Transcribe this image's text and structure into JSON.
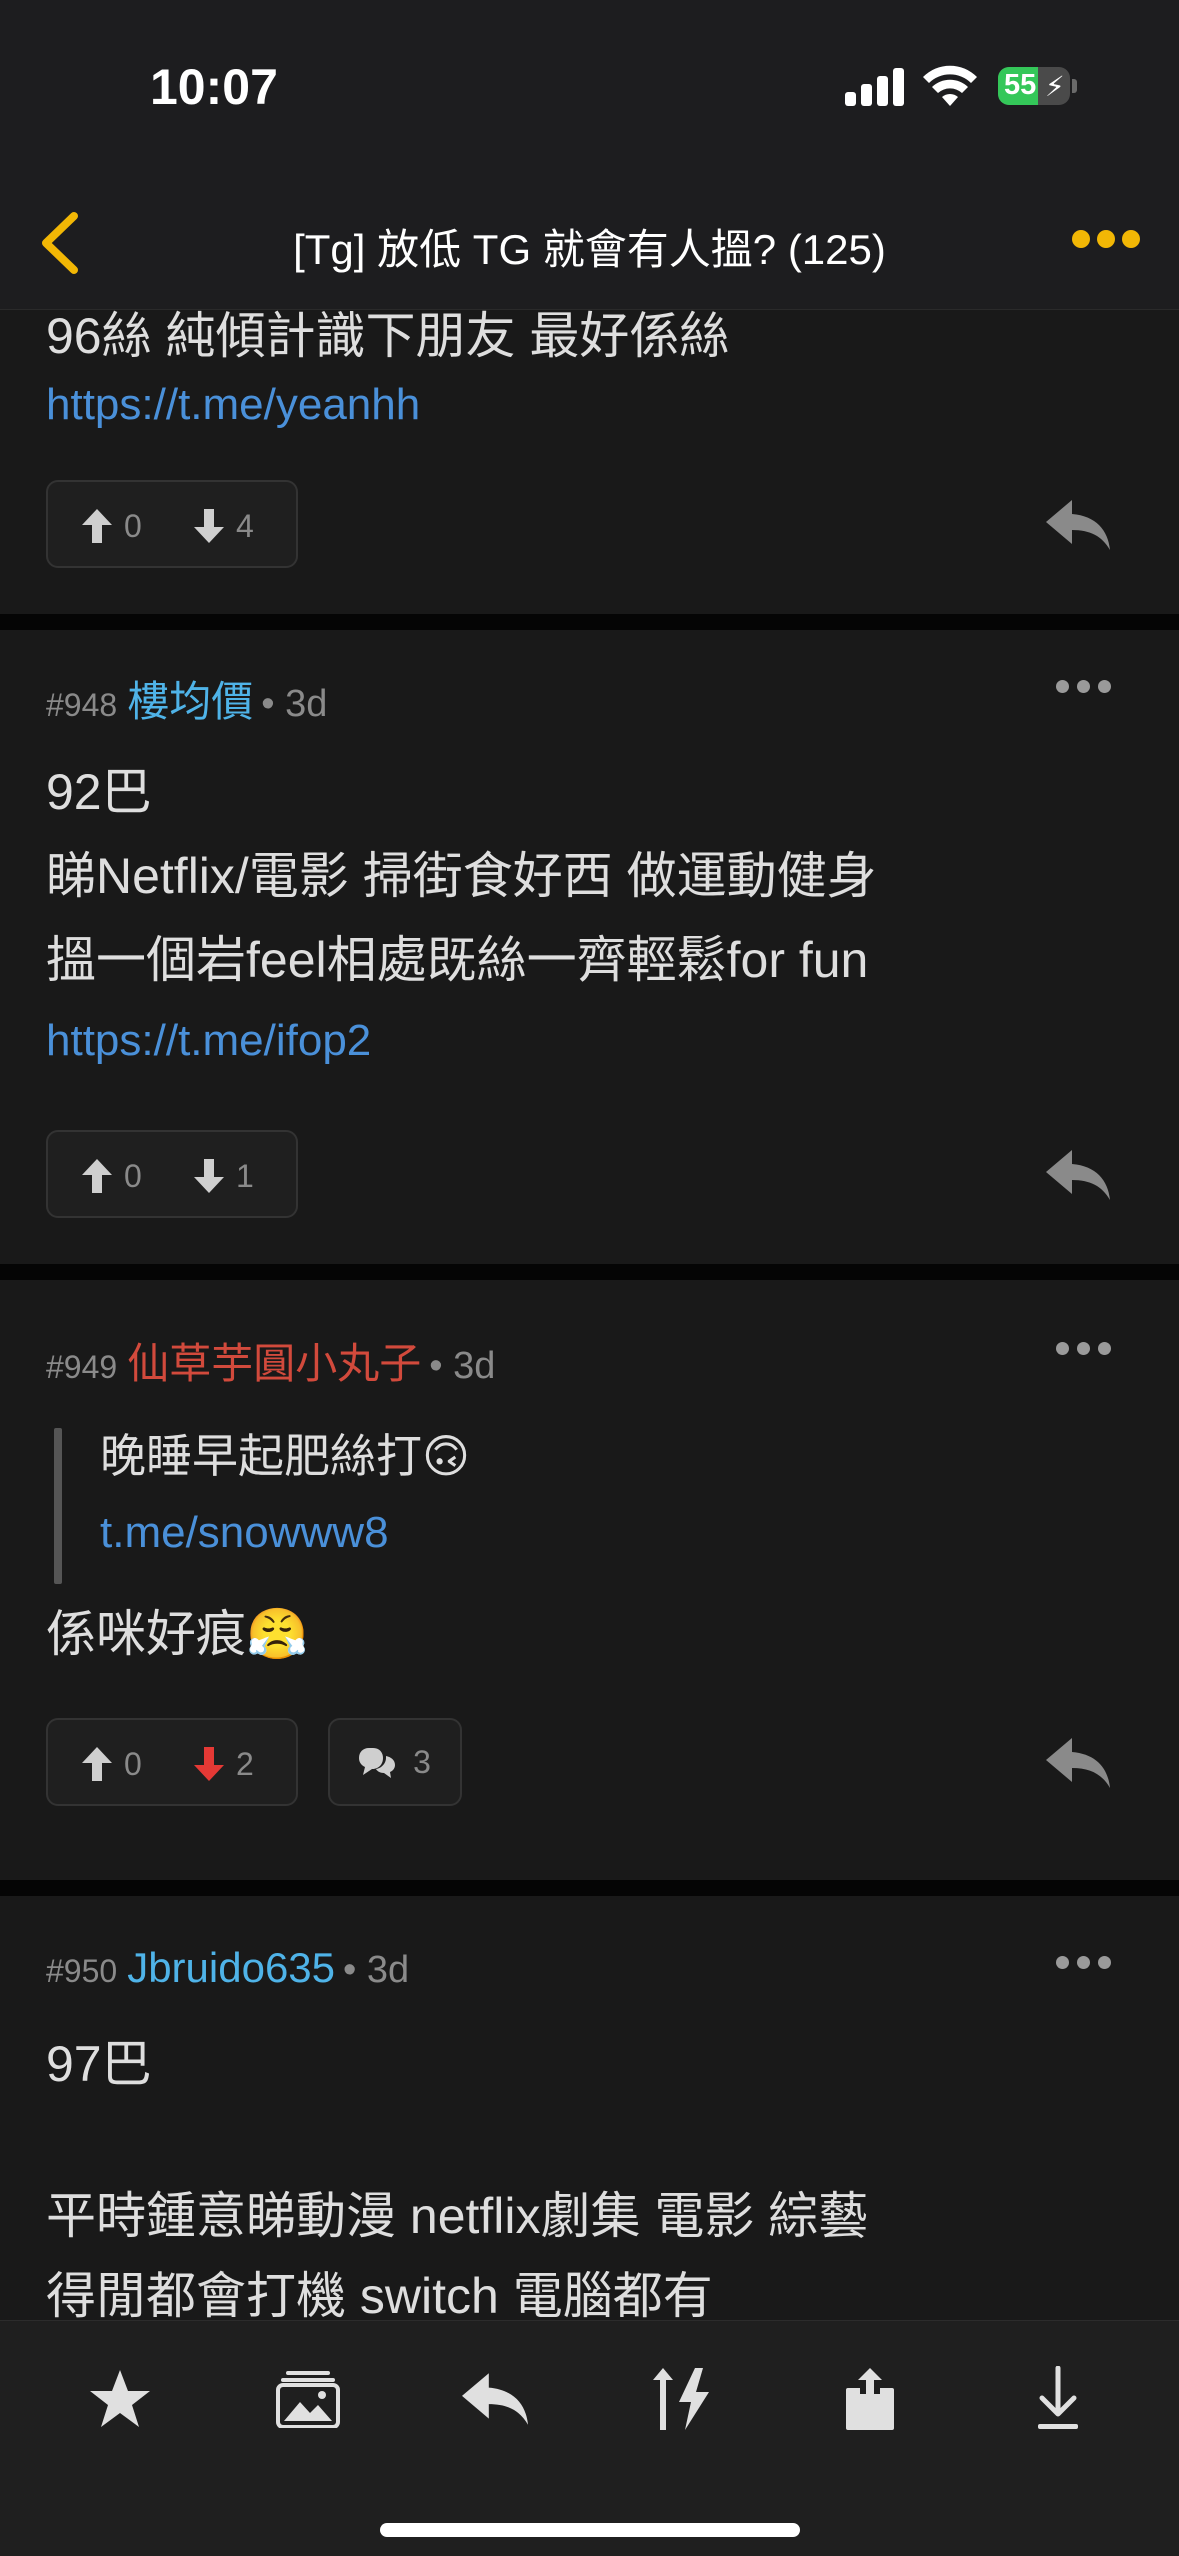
{
  "status": {
    "time": "10:07",
    "battery": "55",
    "battery_level": 0.55
  },
  "nav": {
    "title": "[Tg] 放低 TG 就會有人搵? (125)"
  },
  "colors": {
    "accent": "#f2b705",
    "link": "#4a90d9",
    "user_blue": "#4fb3e8",
    "user_red": "#d24a3c",
    "downvote_active": "#e53935"
  },
  "posts": [
    {
      "lines": [
        "96絲 純傾計識下朋友 最好係絲"
      ],
      "link": "https://t.me/yeanhh",
      "up": "0",
      "down": "4"
    },
    {
      "number": "#948",
      "user": "樓均價",
      "age": "• 3d",
      "lines": [
        "92巴",
        "睇Netflix/電影 掃街食好西 做運動健身",
        "搵一個岩feel相處既絲一齊輕鬆for fun"
      ],
      "link": "https://t.me/ifop2",
      "up": "0",
      "down": "1"
    },
    {
      "number": "#949",
      "user": "仙草芋圓小丸子",
      "age": "• 3d",
      "quote_text": "晚睡早起肥絲打🙃",
      "quote_link": "t.me/snowww8",
      "lines": [
        "係咪好痕😤"
      ],
      "up": "0",
      "down": "2",
      "comments": "3"
    },
    {
      "number": "#950",
      "user": "Jbruido635",
      "age": "• 3d",
      "lines": [
        "97巴",
        "",
        "平時鍾意睇動漫 netflix劇集 電影 綜藝",
        "得閒都會打機 switch 電腦都有"
      ]
    }
  ],
  "toolbar": [
    "star-icon",
    "gallery-icon",
    "reply-icon",
    "sort-icon",
    "share-icon",
    "download-icon"
  ]
}
